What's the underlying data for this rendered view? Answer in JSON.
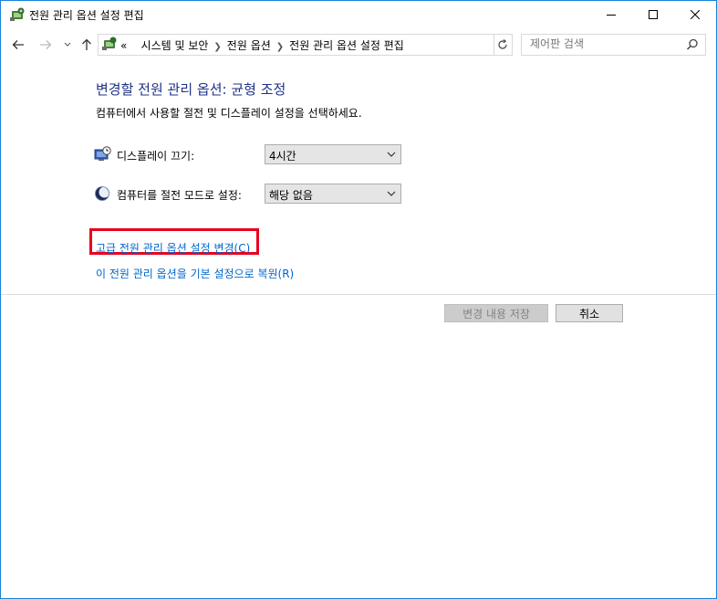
{
  "window": {
    "title": "전원 관리 옵션 설정 편집"
  },
  "address": {
    "overflow": "«",
    "crumbs": [
      "시스템 및 보안",
      "전원 옵션",
      "전원 관리 옵션 설정 편집"
    ]
  },
  "search": {
    "placeholder": "제어판 검색"
  },
  "content": {
    "heading": "변경할 전원 관리 옵션: 균형 조정",
    "subtitle": "컴퓨터에서 사용할 절전 및 디스플레이 설정을 선택하세요.",
    "display_off": {
      "label": "디스플레이 끄기:",
      "value": "4시간"
    },
    "sleep": {
      "label": "컴퓨터를 절전 모드로 설정:",
      "value": "해당 없음"
    },
    "advanced_link": "고급 전원 관리 옵션 설정 변경(C)",
    "restore_link": "이 전원 관리 옵션을 기본 설정으로 복원(R)"
  },
  "buttons": {
    "save": "변경 내용 저장",
    "cancel": "취소"
  },
  "colors": {
    "heading": "#1e3287",
    "link": "#0066cc",
    "highlight": "#e8001c",
    "window_border": "#1883d7"
  },
  "icons": {
    "app": "power-options-icon",
    "display": "display-clock-icon",
    "sleep": "moon-icon"
  }
}
